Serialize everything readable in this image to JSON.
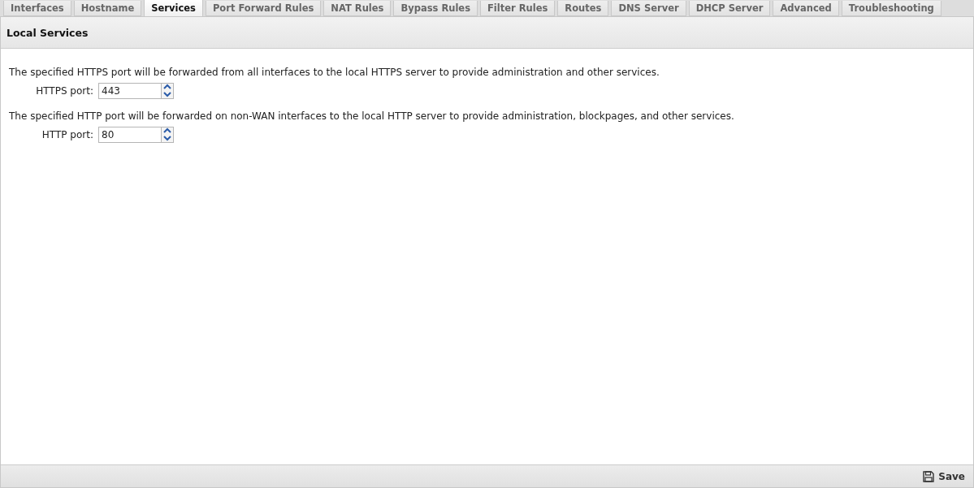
{
  "tabs": [
    {
      "label": "Interfaces",
      "selected": false
    },
    {
      "label": "Hostname",
      "selected": false
    },
    {
      "label": "Services",
      "selected": true
    },
    {
      "label": "Port Forward Rules",
      "selected": false
    },
    {
      "label": "NAT Rules",
      "selected": false
    },
    {
      "label": "Bypass Rules",
      "selected": false
    },
    {
      "label": "Filter Rules",
      "selected": false
    },
    {
      "label": "Routes",
      "selected": false
    },
    {
      "label": "DNS Server",
      "selected": false
    },
    {
      "label": "DHCP Server",
      "selected": false
    },
    {
      "label": "Advanced",
      "selected": false
    },
    {
      "label": "Troubleshooting",
      "selected": false
    }
  ],
  "panel": {
    "title": "Local Services",
    "fields": [
      {
        "description": "The specified HTTPS port will be forwarded from all interfaces to the local HTTPS server to provide administration and other services.",
        "label": "HTTPS port:",
        "value": "443"
      },
      {
        "description": "The specified HTTP port will be forwarded on non-WAN interfaces to the local HTTP server to provide administration, blockpages, and other services.",
        "label": "HTTP port:",
        "value": "80"
      }
    ]
  },
  "footer": {
    "save_button": "Save"
  }
}
